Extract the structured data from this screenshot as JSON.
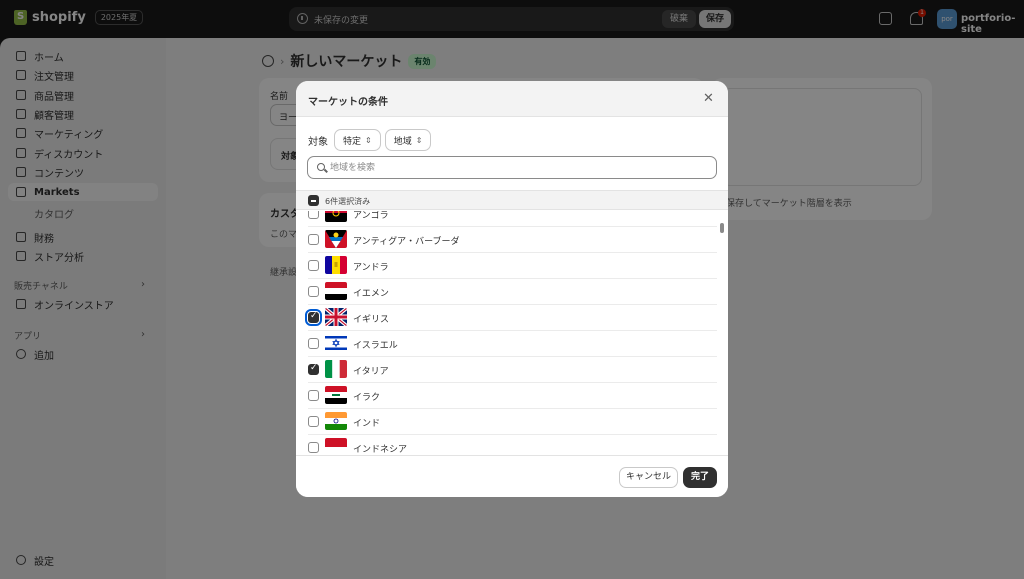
{
  "topbar": {
    "logo_text": "shopify",
    "edition": "2025年夏",
    "unsaved_text": "未保存の変更",
    "discard_label": "破棄",
    "save_label": "保存",
    "notification_count": "1",
    "avatar_initials": "por",
    "store_name": "portforio-site"
  },
  "sidebar": {
    "items": [
      {
        "label": "ホーム",
        "icon": "home-icon"
      },
      {
        "label": "注文管理",
        "icon": "inbox-icon"
      },
      {
        "label": "商品管理",
        "icon": "tag-icon"
      },
      {
        "label": "顧客管理",
        "icon": "person-icon"
      },
      {
        "label": "マーケティング",
        "icon": "target-icon"
      },
      {
        "label": "ディスカウント",
        "icon": "discount-icon"
      },
      {
        "label": "コンテンツ",
        "icon": "content-icon"
      },
      {
        "label": "Markets",
        "icon": "globe-icon"
      }
    ],
    "sub_item": "カタログ",
    "items2": [
      {
        "label": "財務",
        "icon": "bank-icon"
      },
      {
        "label": "ストア分析",
        "icon": "chart-icon"
      }
    ],
    "sales_channels_title": "販売チャネル",
    "online_store": "オンラインストア",
    "apps_title": "アプリ",
    "add_label": "追加",
    "settings_label": "設定"
  },
  "main": {
    "page_title": "新しいマーケット",
    "status_badge": "有効",
    "name_label": "名前",
    "name_value_partial": "ヨー",
    "target_partial": "対象",
    "custom_partial": "カスタ",
    "custom_desc_partial": "このマ",
    "inherit_partial": "継承設",
    "hierarchy_link": "保存してマーケット階層を表示"
  },
  "modal": {
    "title": "マーケットの条件",
    "target_label": "対象",
    "select_specific": "特定",
    "select_region": "地域",
    "search_placeholder": "地域を検索",
    "selected_count": "6件選択済み",
    "countries": [
      {
        "name": "アンゴラ",
        "checked": false
      },
      {
        "name": "アンティグア・バーブーダ",
        "checked": false
      },
      {
        "name": "アンドラ",
        "checked": false
      },
      {
        "name": "イエメン",
        "checked": false
      },
      {
        "name": "イギリス",
        "checked": true
      },
      {
        "name": "イスラエル",
        "checked": false
      },
      {
        "name": "イタリア",
        "checked": true
      },
      {
        "name": "イラク",
        "checked": false
      },
      {
        "name": "インド",
        "checked": false
      },
      {
        "name": "インドネシア",
        "checked": false
      }
    ],
    "cancel_label": "キャンセル",
    "done_label": "完了"
  },
  "colors": {
    "topbar_bg": "#1a1a1a",
    "primary_button": "#303030",
    "active_badge_bg": "#cdfed4",
    "focus_ring": "#005bd3"
  }
}
